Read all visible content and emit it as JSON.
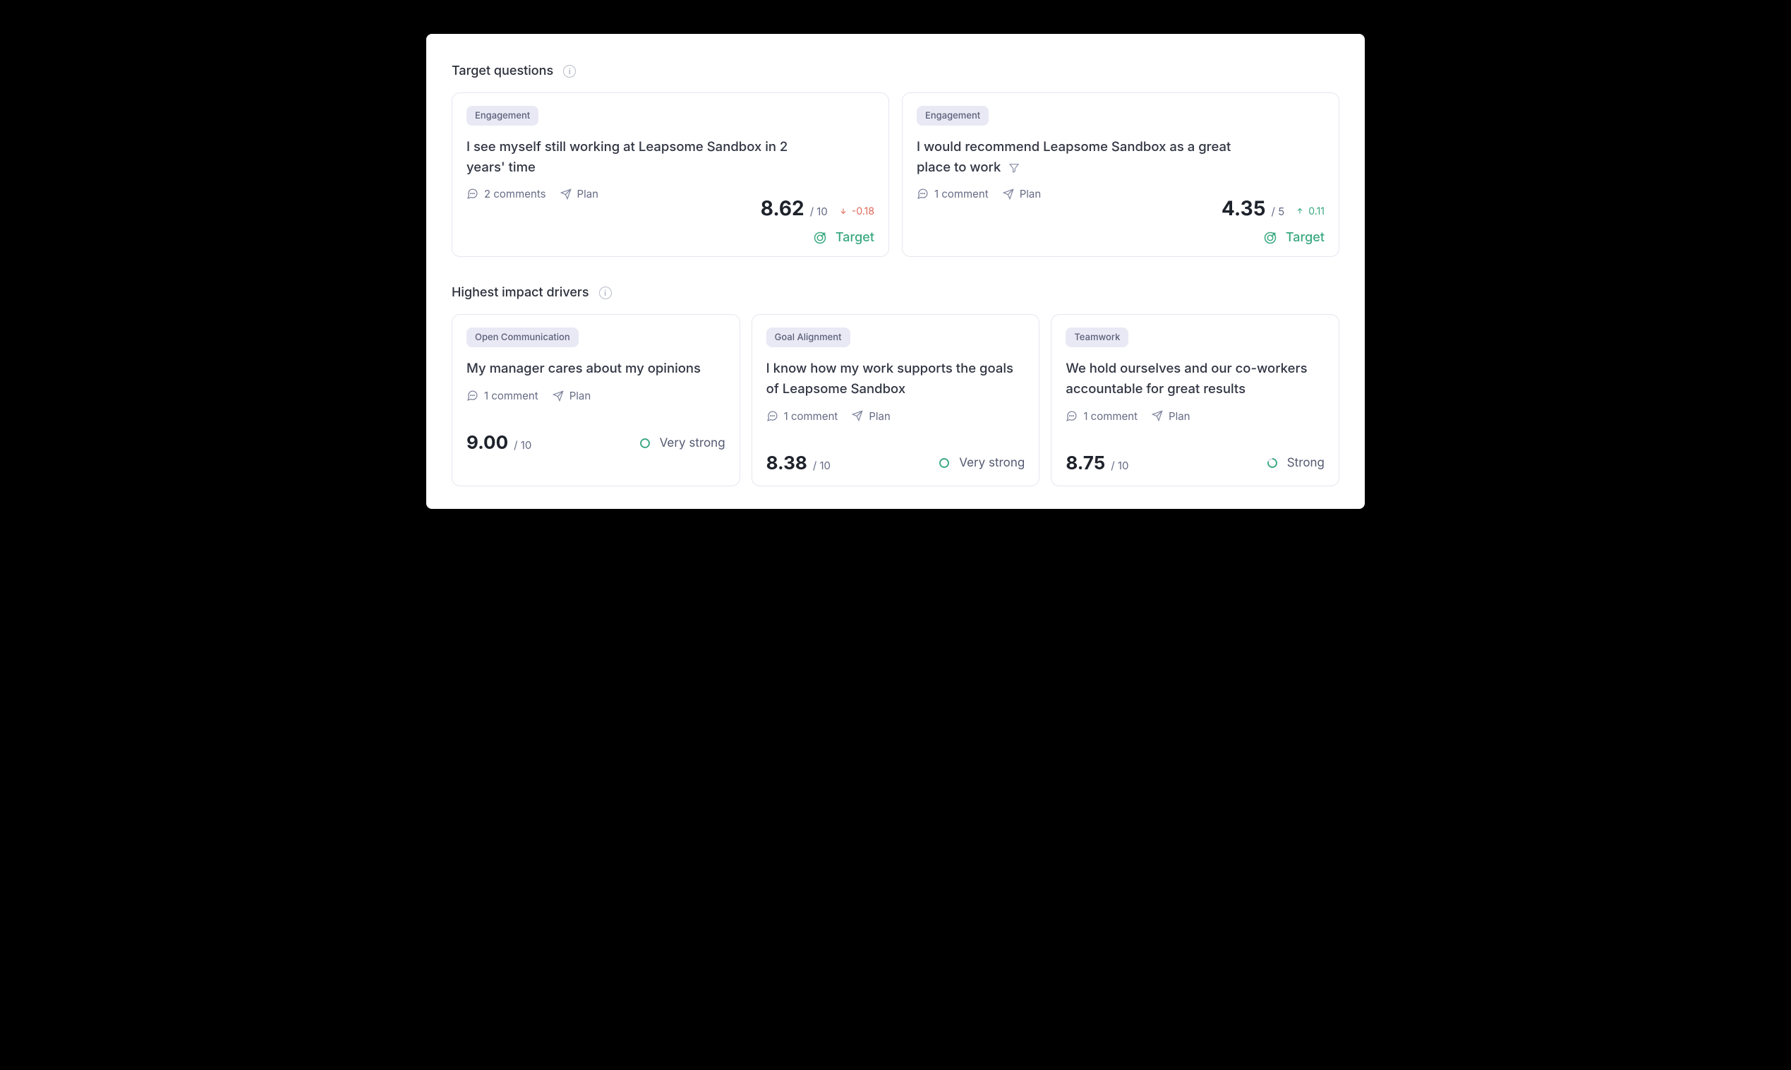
{
  "sections": {
    "target": {
      "title": "Target questions",
      "cards": [
        {
          "chip": "Engagement",
          "question": "I see myself still working at Leapsome Sandbox in 2 years' time",
          "comments": "2 comments",
          "plan": "Plan",
          "score": "8.62",
          "outof": "/ 10",
          "deltaDir": "down",
          "delta": "-0.18",
          "targetLabel": "Target",
          "hasFilter": false
        },
        {
          "chip": "Engagement",
          "question": "I would recommend Leapsome Sandbox as a great place to work",
          "comments": "1 comment",
          "plan": "Plan",
          "score": "4.35",
          "outof": "/ 5",
          "deltaDir": "up",
          "delta": "0.11",
          "targetLabel": "Target",
          "hasFilter": true
        }
      ]
    },
    "drivers": {
      "title": "Highest impact drivers",
      "cards": [
        {
          "chip": "Open Communication",
          "question": "My manager cares about my opinions",
          "comments": "1 comment",
          "plan": "Plan",
          "score": "9.00",
          "outof": "/ 10",
          "strength": "Very strong",
          "ringPct": 100
        },
        {
          "chip": "Goal Alignment",
          "question": "I know how my work supports the goals of Leapsome Sandbox",
          "comments": "1 comment",
          "plan": "Plan",
          "score": "8.38",
          "outof": "/ 10",
          "strength": "Very strong",
          "ringPct": 100
        },
        {
          "chip": "Teamwork",
          "question": "We hold ourselves and our co-workers accountable for great results",
          "comments": "1 comment",
          "plan": "Plan",
          "score": "8.75",
          "outof": "/ 10",
          "strength": "Strong",
          "ringPct": 80
        }
      ]
    }
  }
}
